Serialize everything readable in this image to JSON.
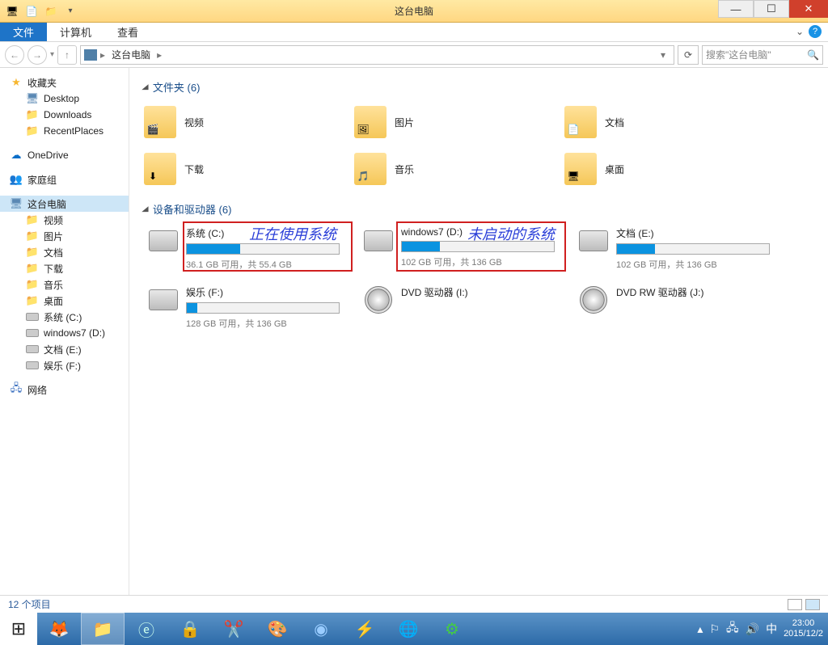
{
  "window": {
    "title": "这台电脑"
  },
  "ribbon": {
    "file": "文件",
    "tabs": [
      "计算机",
      "查看"
    ]
  },
  "nav": {
    "location": "这台电脑",
    "search_placeholder": "搜索\"这台电脑\""
  },
  "sidebar": {
    "favorites": {
      "header": "收藏夹",
      "items": [
        "Desktop",
        "Downloads",
        "RecentPlaces"
      ]
    },
    "onedrive": "OneDrive",
    "homegroup": "家庭组",
    "thispc": {
      "header": "这台电脑",
      "items": [
        "视频",
        "图片",
        "文档",
        "下载",
        "音乐",
        "桌面",
        "系统 (C:)",
        "windows7 (D:)",
        "文档 (E:)",
        "娱乐 (F:)"
      ]
    },
    "network": "网络"
  },
  "main": {
    "folders_header": "文件夹 (6)",
    "folders": [
      "视频",
      "图片",
      "文档",
      "下载",
      "音乐",
      "桌面"
    ],
    "drives_header": "设备和驱动器 (6)",
    "drives": [
      {
        "name": "系统 (C:)",
        "size": "36.1 GB 可用，共 55.4 GB",
        "fill": 35
      },
      {
        "name": "windows7 (D:)",
        "size": "102 GB 可用，共 136 GB",
        "fill": 25
      },
      {
        "name": "文档 (E:)",
        "size": "102 GB 可用，共 136 GB",
        "fill": 25
      },
      {
        "name": "娱乐 (F:)",
        "size": "128 GB 可用，共 136 GB",
        "fill": 7
      },
      {
        "name": "DVD 驱动器 (I:)",
        "size": "",
        "fill": -1,
        "dvd": true
      },
      {
        "name": "DVD RW 驱动器 (J:)",
        "size": "",
        "fill": -1,
        "dvd": true
      }
    ],
    "annotations": {
      "a1": "正在使用系统",
      "a2": "未启动的系统"
    }
  },
  "status": {
    "count": "12 个项目"
  },
  "taskbar": {
    "time": "23:00",
    "date": "2015/12/2"
  }
}
